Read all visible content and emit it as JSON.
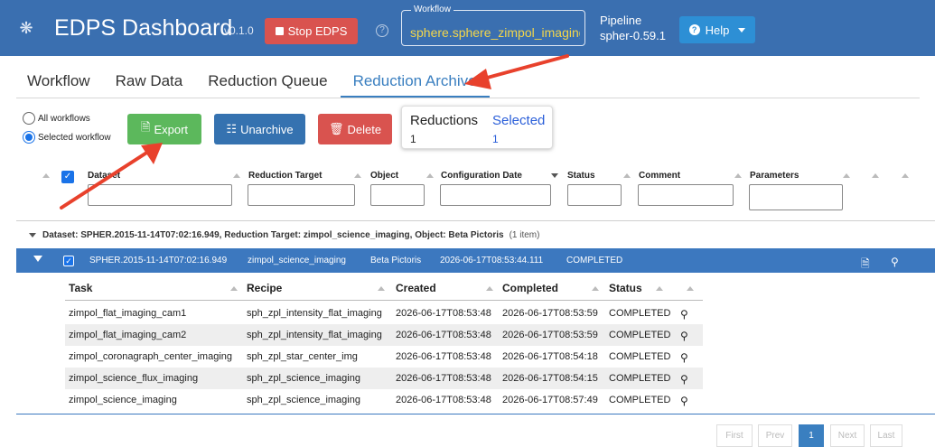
{
  "header": {
    "logo_icon": "eso-logo-icon",
    "title": "EDPS Dashboard",
    "version": "v0.1.0",
    "stop_label": "Stop EDPS",
    "workflow_legend": "Workflow",
    "workflow_value": "sphere.sphere_zimpol_imaging",
    "pipeline_label": "Pipeline",
    "pipeline_value": "spher-0.59.1",
    "help_label": "Help"
  },
  "tabs": [
    "Workflow",
    "Raw Data",
    "Reduction Queue",
    "Reduction Archive"
  ],
  "active_tab": "Reduction Archive",
  "filter_options": {
    "all_workflows": "All workflows",
    "selected_workflow": "Selected workflow",
    "selected": "Selected workflow"
  },
  "actions": {
    "export": "Export",
    "unarchive": "Unarchive",
    "delete": "Delete"
  },
  "summary": {
    "reductions_label": "Reductions",
    "reductions_value": "1",
    "selected_label": "Selected",
    "selected_value": "1"
  },
  "columns": [
    "Dataset",
    "Reduction Target",
    "Object",
    "Configuration Date",
    "Status",
    "Comment",
    "Parameters"
  ],
  "sort_column": "Configuration Date",
  "group": {
    "label": "Dataset: SPHER.2015-11-14T07:02:16.949, Reduction Target: zimpol_science_imaging, Object: Beta Pictoris",
    "count": "(1 item)"
  },
  "selected_row": {
    "dataset": "SPHER.2015-11-14T07:02:16.949",
    "target": "zimpol_science_imaging",
    "object": "Beta Pictoris",
    "date": "2026-06-17T08:53:44.111",
    "status": "COMPLETED"
  },
  "tasks": {
    "headers": [
      "Task",
      "Recipe",
      "Created",
      "Completed",
      "Status"
    ],
    "rows": [
      {
        "task": "zimpol_flat_imaging_cam1",
        "recipe": "sph_zpl_intensity_flat_imaging",
        "created": "2026-06-17T08:53:48",
        "completed": "2026-06-17T08:53:59",
        "status": "COMPLETED"
      },
      {
        "task": "zimpol_flat_imaging_cam2",
        "recipe": "sph_zpl_intensity_flat_imaging",
        "created": "2026-06-17T08:53:48",
        "completed": "2026-06-17T08:53:59",
        "status": "COMPLETED"
      },
      {
        "task": "zimpol_coronagraph_center_imaging",
        "recipe": "sph_zpl_star_center_img",
        "created": "2026-06-17T08:53:48",
        "completed": "2026-06-17T08:54:18",
        "status": "COMPLETED"
      },
      {
        "task": "zimpol_science_flux_imaging",
        "recipe": "sph_zpl_science_imaging",
        "created": "2026-06-17T08:53:48",
        "completed": "2026-06-17T08:54:15",
        "status": "COMPLETED"
      },
      {
        "task": "zimpol_science_imaging",
        "recipe": "sph_zpl_science_imaging",
        "created": "2026-06-17T08:53:48",
        "completed": "2026-06-17T08:57:49",
        "status": "COMPLETED"
      }
    ]
  },
  "pagination": {
    "first": "First",
    "prev": "Prev",
    "current": "1",
    "next": "Next",
    "last": "Last"
  },
  "colors": {
    "topbar": "#3a6fb0",
    "accent": "#3a7fc0",
    "export": "#5cb85c",
    "unarchive": "#3572b0",
    "delete": "#d9534f",
    "annotation_arrow": "#e8412c"
  }
}
